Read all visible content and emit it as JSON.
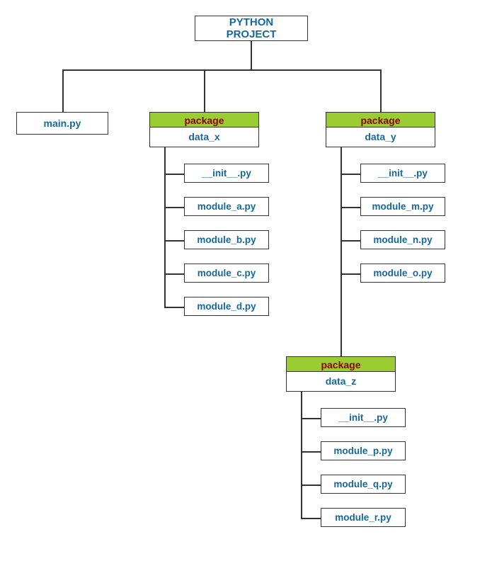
{
  "root": {
    "title": "PYTHON PROJECT"
  },
  "main_file": "main.py",
  "packages": {
    "data_x": {
      "header": "package",
      "name": "data_x",
      "modules": [
        "__init__.py",
        "module_a.py",
        "module_b.py",
        "module_c.py",
        "module_d.py"
      ]
    },
    "data_y": {
      "header": "package",
      "name": "data_y",
      "modules": [
        "__init__.py",
        "module_m.py",
        "module_n.py",
        "module_o.py"
      ]
    },
    "data_z": {
      "header": "package",
      "name": "data_z",
      "modules": [
        "__init__.py",
        "module_p.py",
        "module_q.py",
        "module_r.py"
      ]
    }
  }
}
